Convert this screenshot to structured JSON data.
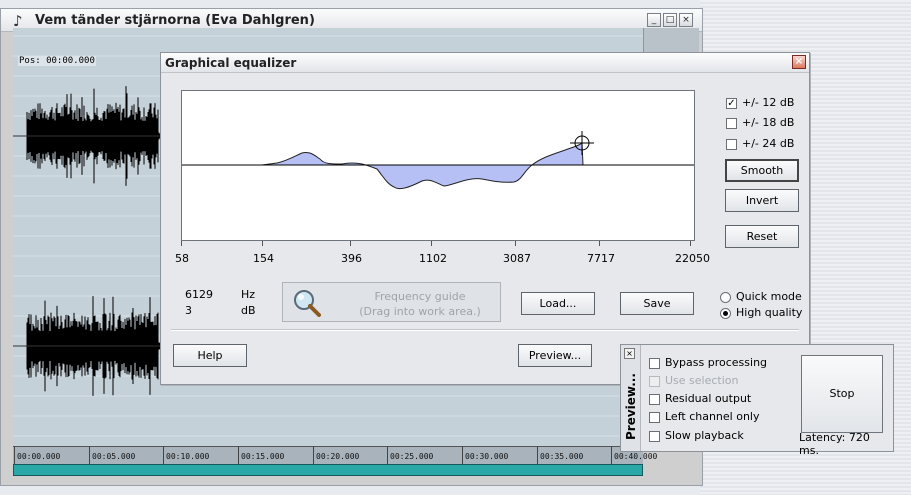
{
  "main_window": {
    "title": "Vem tänder stjärnorna (Eva Dahlgren)",
    "position_label": "Pos: 00:00.000",
    "timeline_ticks": [
      "00:00.000",
      "00:05.000",
      "00:10.000",
      "00:15.000",
      "00:20.000",
      "00:25.000",
      "00:30.000",
      "00:35.000",
      "00:40.000"
    ],
    "buttons": {
      "minimize": "_",
      "maximize": "□",
      "close": "×"
    }
  },
  "equalizer": {
    "title": "Graphical equalizer",
    "close": "×",
    "freq_ticks": [
      "58",
      "154",
      "396",
      "1102",
      "3087",
      "7717",
      "22050"
    ],
    "range_options": [
      {
        "label": "+/- 12 dB",
        "checked": true
      },
      {
        "label": "+/- 18 dB",
        "checked": false
      },
      {
        "label": "+/- 24 dB",
        "checked": false
      }
    ],
    "buttons": {
      "smooth": "Smooth",
      "invert": "Invert",
      "reset": "Reset",
      "load": "Load...",
      "save": "Save",
      "help": "Help",
      "preview": "Preview..."
    },
    "readout": {
      "freq_value": "6129",
      "freq_unit": "Hz",
      "gain_value": "3",
      "gain_unit": "dB"
    },
    "frequency_guide": {
      "line1": "Frequency guide",
      "line2": "(Drag into work area.)"
    },
    "quality_options": [
      {
        "label": "Quick mode",
        "selected": false
      },
      {
        "label": "High quality",
        "selected": true
      }
    ]
  },
  "preview_panel": {
    "close": "×",
    "side_title": "Preview...",
    "options": [
      {
        "label": "Bypass processing",
        "disabled": false
      },
      {
        "label": "Use selection",
        "disabled": true
      },
      {
        "label": "Residual output",
        "disabled": false
      },
      {
        "label": "Left channel only",
        "disabled": false
      },
      {
        "label": "Slow playback",
        "disabled": false
      }
    ],
    "stop_label": "Stop",
    "latency": "Latency: 720 ms."
  },
  "colors": {
    "eq_fill": "#b6c0f4",
    "waveform": "#000000",
    "wave_bg": "#c5d1d9",
    "scrollbar": "#2aa7a7"
  }
}
